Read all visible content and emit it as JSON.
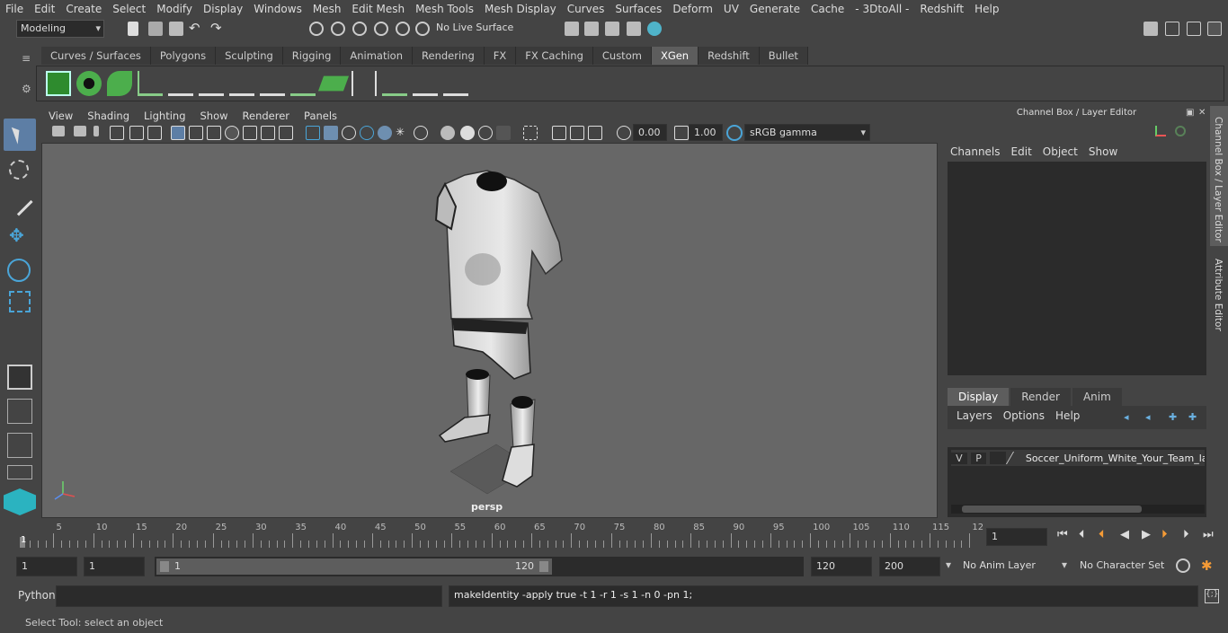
{
  "menu": [
    "File",
    "Edit",
    "Create",
    "Select",
    "Modify",
    "Display",
    "Windows",
    "Mesh",
    "Edit Mesh",
    "Mesh Tools",
    "Mesh Display",
    "Curves",
    "Surfaces",
    "Deform",
    "UV",
    "Generate",
    "Cache",
    "- 3DtoAll -",
    "Redshift",
    "Help"
  ],
  "status": {
    "mode": "Modeling",
    "live_surface": "No Live Surface"
  },
  "shelf_tabs": [
    "Curves / Surfaces",
    "Polygons",
    "Sculpting",
    "Rigging",
    "Animation",
    "Rendering",
    "FX",
    "FX Caching",
    "Custom",
    "XGen",
    "Redshift",
    "Bullet"
  ],
  "active_shelf": "XGen",
  "viewport": {
    "menu": [
      "View",
      "Shading",
      "Lighting",
      "Show",
      "Renderer",
      "Panels"
    ],
    "exposure": "0.00",
    "gamma": "1.00",
    "color_space": "sRGB gamma",
    "camera_label": "persp"
  },
  "channel_box": {
    "title": "Channel Box / Layer Editor",
    "menu": [
      "Channels",
      "Edit",
      "Object",
      "Show"
    ],
    "layer_tabs": [
      "Display",
      "Render",
      "Anim"
    ],
    "active_layer_tab": "Display",
    "layer_menu": [
      "Layers",
      "Options",
      "Help"
    ],
    "layer": {
      "v": "V",
      "p": "P",
      "name": "Soccer_Uniform_White_Your_Team_la"
    }
  },
  "side_tabs": {
    "channel": "Channel Box / Layer Editor",
    "attribute": "Attribute Editor"
  },
  "timeline": {
    "ticks": [
      "5",
      "10",
      "15",
      "20",
      "25",
      "30",
      "35",
      "40",
      "45",
      "50",
      "55",
      "60",
      "65",
      "70",
      "75",
      "80",
      "85",
      "90",
      "95",
      "100",
      "105",
      "110",
      "115",
      "12"
    ],
    "start_marker": "1",
    "current_frame": "1"
  },
  "range": {
    "start": "1",
    "inner_start": "1",
    "slider_start": "1",
    "slider_end": "120",
    "end": "120",
    "anim_end": "200",
    "anim_layer": "No Anim Layer",
    "character_set": "No Character Set"
  },
  "command": {
    "lang": "Python",
    "output": "makeIdentity -apply true -t 1 -r 1 -s 1 -n 0 -pn 1;"
  },
  "help_line": "Select Tool: select an object"
}
